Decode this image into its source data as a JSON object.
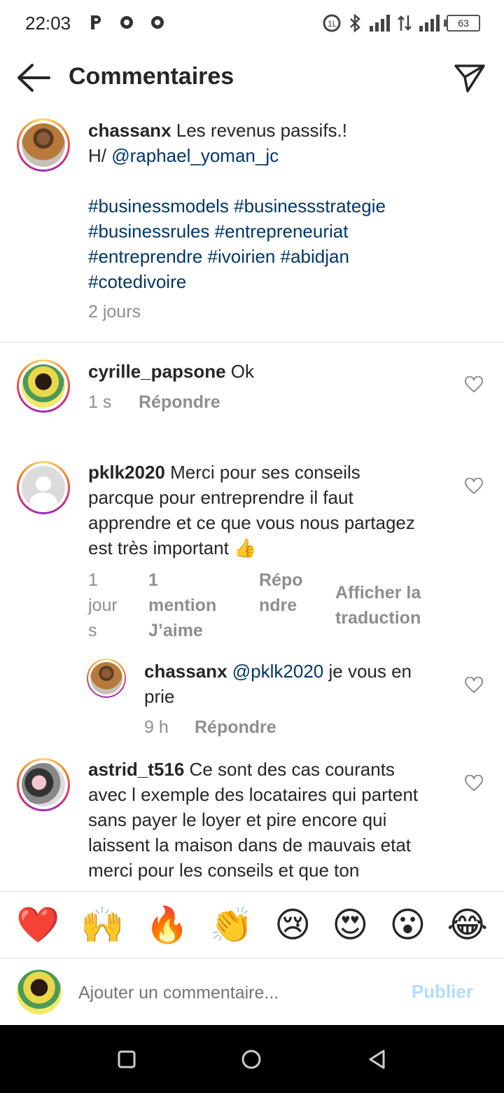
{
  "status_bar": {
    "time": "22:03",
    "battery": "63"
  },
  "header": {
    "title": "Commentaires"
  },
  "caption": {
    "username": "chassanx",
    "text_line1": "Les revenus passifs.!",
    "text_prefix": "H/",
    "mention": "@raphael_yoman_jc",
    "hashtags": [
      "#businessmodels #businessstrategie",
      "#businessrules #entrepreneuriat",
      "#entreprendre #ivoirien #abidjan",
      "#cotedivoire"
    ],
    "time": "2 jours"
  },
  "comments": [
    {
      "username": "cyrille_papsone",
      "text": "Ok",
      "time": "1 s",
      "reply_label": "Répondre"
    },
    {
      "username": "pklk2020",
      "lines": [
        "Merci pour ses conseils",
        "parcque pour entreprendre il faut",
        "apprendre et ce que vous nous partagez",
        "est très important 👍"
      ],
      "time_lines": [
        "1",
        "jour",
        "s"
      ],
      "likes_lines": [
        "1",
        "mention",
        "J’aime"
      ],
      "reply_lines": [
        "Répo",
        "ndre"
      ],
      "translate_lines": [
        "Afficher la",
        "traduction"
      ]
    },
    {
      "username": "chassanx",
      "mention": "@pklk2020",
      "text_after": "je vous en",
      "text_line2": "prie",
      "time": "9 h",
      "reply_label": "Répondre"
    },
    {
      "username": "astrid_t516",
      "lines": [
        "Ce sont des cas courants",
        "avec l exemple des locataires qui partent",
        "sans payer le loyer et pire encore qui",
        "laissent la maison dans de mauvais  etat",
        "merci pour les conseils et que ton"
      ]
    }
  ],
  "emoji_bar": [
    "❤️",
    "🙌",
    "🔥",
    "👏",
    "😢",
    "😍",
    "😮",
    "😂"
  ],
  "composer": {
    "placeholder": "Ajouter un commentaire...",
    "publish_label": "Publier"
  },
  "colors": {
    "link": "#00376b",
    "muted": "#8e8e8e",
    "publish_disabled": "#b3dbff"
  }
}
